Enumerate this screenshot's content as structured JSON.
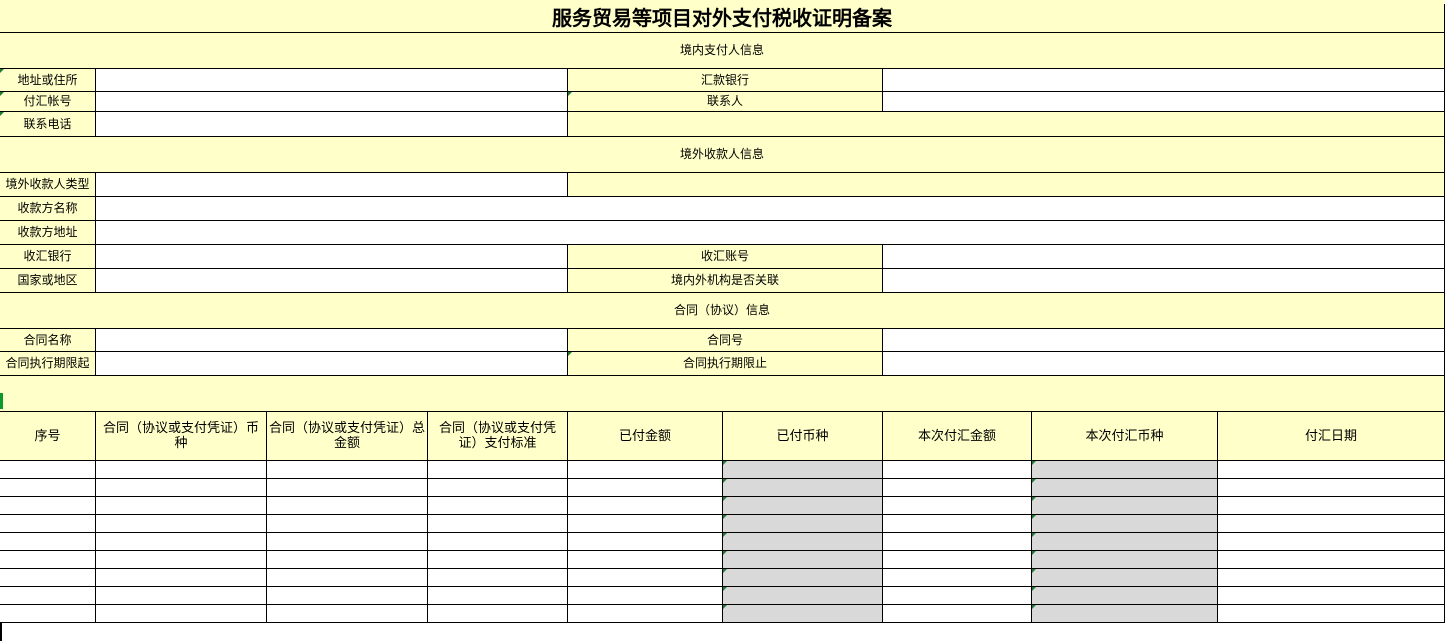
{
  "title": "服务贸易等项目对外支付税收证明备案",
  "sections": {
    "payer": "境内支付人信息",
    "payee": "境外收款人信息",
    "contract": "合同（协议）信息"
  },
  "labels": {
    "address": "地址或住所",
    "remit_bank": "汇款银行",
    "pay_account": "付汇帐号",
    "contact_person": "联系人",
    "contact_phone": "联系电话",
    "payee_type": "境外收款人类型",
    "payee_name": "收款方名称",
    "payee_address": "收款方地址",
    "receive_bank": "收汇银行",
    "receive_account": "收汇账号",
    "country_region": "国家或地区",
    "related": "境内外机构是否关联",
    "contract_name": "合同名称",
    "contract_no": "合同号",
    "contract_start": "合同执行期限起",
    "contract_end": "合同执行期限止"
  },
  "table": {
    "headers": [
      "序号",
      "合同（协议或支付凭证）币种",
      "合同（协议或支付凭证）总金额",
      "合同（协议或支付凭证）支付标准",
      "已付金额",
      "已付币种",
      "本次付汇金额",
      "本次付汇币种",
      "付汇日期"
    ],
    "rows": [
      [
        "",
        "",
        "",
        "",
        "",
        "",
        "",
        "",
        ""
      ],
      [
        "",
        "",
        "",
        "",
        "",
        "",
        "",
        "",
        ""
      ],
      [
        "",
        "",
        "",
        "",
        "",
        "",
        "",
        "",
        ""
      ],
      [
        "",
        "",
        "",
        "",
        "",
        "",
        "",
        "",
        ""
      ],
      [
        "",
        "",
        "",
        "",
        "",
        "",
        "",
        "",
        ""
      ],
      [
        "",
        "",
        "",
        "",
        "",
        "",
        "",
        "",
        ""
      ],
      [
        "",
        "",
        "",
        "",
        "",
        "",
        "",
        "",
        ""
      ],
      [
        "",
        "",
        "",
        "",
        "",
        "",
        "",
        "",
        ""
      ],
      [
        "",
        "",
        "",
        "",
        "",
        "",
        "",
        "",
        ""
      ]
    ]
  },
  "colors": {
    "label_fill": "#ffffc9",
    "locked_fill": "#d9d9d9",
    "grid": "#000000",
    "comment_marker": "#1e7b34"
  }
}
